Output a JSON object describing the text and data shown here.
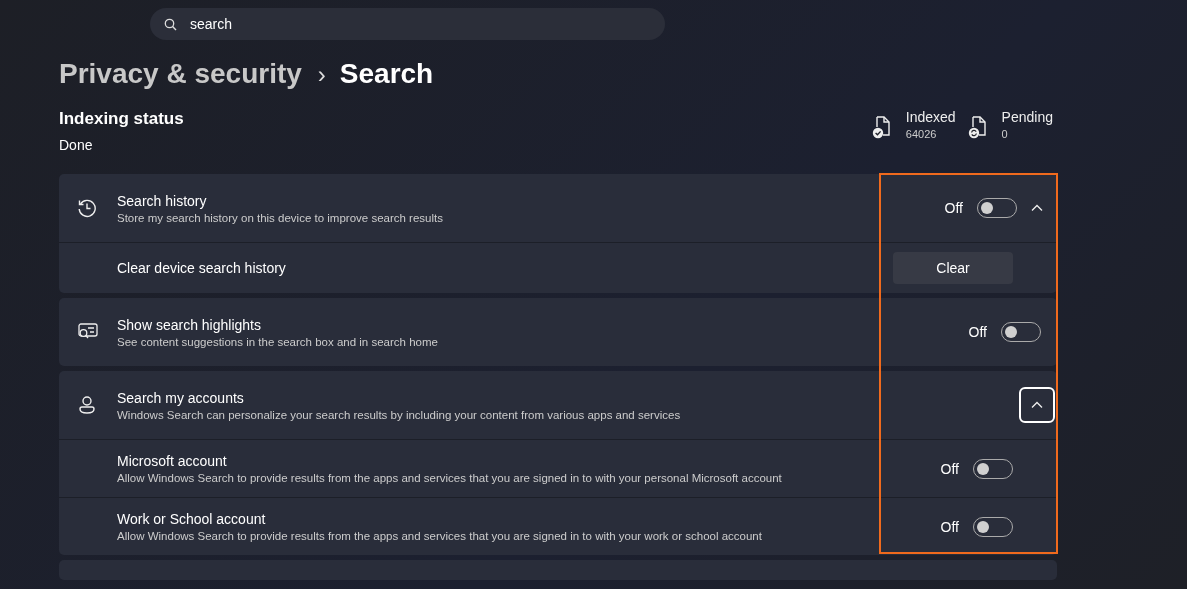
{
  "search": {
    "value": "search"
  },
  "breadcrumb": {
    "parent": "Privacy & security",
    "separator": "›",
    "current": "Search"
  },
  "indexing": {
    "title": "Indexing status",
    "status": "Done",
    "stats": [
      {
        "label": "Indexed",
        "value": "64026"
      },
      {
        "label": "Pending",
        "value": "0"
      }
    ]
  },
  "cards": [
    {
      "title": "Search history",
      "description": "Store my search history on this device to improve search results",
      "toggle": {
        "on": false,
        "label": "Off"
      },
      "expanded": true,
      "focused": false,
      "children": [
        {
          "kind": "button",
          "title": "Clear device search history",
          "button": "Clear"
        }
      ]
    },
    {
      "title": "Show search highlights",
      "description": "See content suggestions in the search box and in search home",
      "toggle": {
        "on": false,
        "label": "Off"
      }
    },
    {
      "title": "Search my accounts",
      "description": "Windows Search can personalize your search results by including your content from various apps and services",
      "expanded": true,
      "focused": true,
      "children": [
        {
          "kind": "toggle",
          "title": "Microsoft account",
          "description": "Allow Windows Search to provide results from the apps and services that you are signed in to with your personal Microsoft account",
          "toggle": {
            "on": false,
            "label": "Off"
          }
        },
        {
          "kind": "toggle",
          "title": "Work or School account",
          "description": "Allow Windows Search to provide results from the apps and services that you are signed in to with your work or school account",
          "toggle": {
            "on": false,
            "label": "Off"
          }
        }
      ]
    }
  ],
  "highlight": {
    "shown": true
  }
}
